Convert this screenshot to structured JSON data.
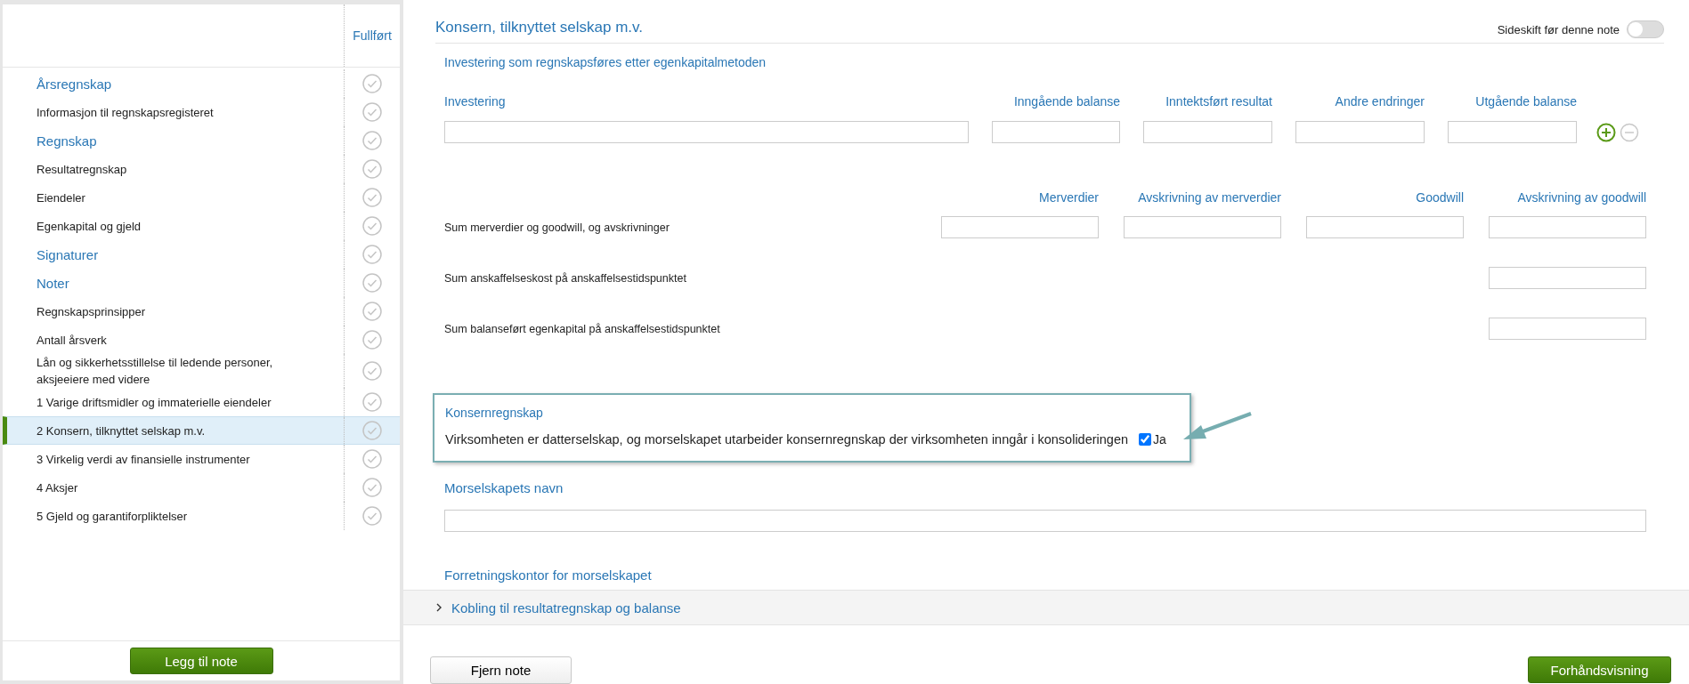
{
  "sidebar": {
    "status_heading": "Fullført",
    "items": [
      {
        "label": "Årsregnskap",
        "kind": "heading",
        "selected": false
      },
      {
        "label": "Informasjon til regnskapsregisteret",
        "kind": "item",
        "selected": false
      },
      {
        "label": "Regnskap",
        "kind": "heading",
        "selected": false
      },
      {
        "label": "Resultatregnskap",
        "kind": "item",
        "selected": false
      },
      {
        "label": "Eiendeler",
        "kind": "item",
        "selected": false
      },
      {
        "label": "Egenkapital og gjeld",
        "kind": "item",
        "selected": false
      },
      {
        "label": "Signaturer",
        "kind": "heading",
        "selected": false
      },
      {
        "label": "Noter",
        "kind": "heading",
        "selected": false
      },
      {
        "label": "Regnskapsprinsipper",
        "kind": "item",
        "selected": false
      },
      {
        "label": "Antall årsverk",
        "kind": "item",
        "selected": false
      },
      {
        "label": "Lån og sikkerhetsstillelse til ledende personer, aksjeeiere med videre",
        "kind": "item",
        "selected": false
      },
      {
        "label": "1 Varige driftsmidler og immaterielle eiendeler",
        "kind": "item",
        "selected": false
      },
      {
        "label": "2 Konsern, tilknyttet selskap m.v.",
        "kind": "item",
        "selected": true
      },
      {
        "label": "3 Virkelig verdi av finansielle instrumenter",
        "kind": "item",
        "selected": false
      },
      {
        "label": "4 Aksjer",
        "kind": "item",
        "selected": false
      },
      {
        "label": "5 Gjeld og garantiforpliktelser",
        "kind": "item",
        "selected": false
      }
    ],
    "add_button": "Legg til note"
  },
  "note": {
    "title": "Konsern, tilknyttet selskap m.v.",
    "page_break": {
      "label": "Sideskift før denne note",
      "on": false
    },
    "investment": {
      "heading": "Investering som regnskapsføres etter egenkapitalmetoden",
      "columns": [
        "Investering",
        "Inngående balanse",
        "Inntektsført resultat",
        "Andre endringer",
        "Utgående balanse"
      ]
    },
    "sums": {
      "columns": [
        "Merverdier",
        "Avskrivning av merverdier",
        "Goodwill",
        "Avskrivning av goodwill"
      ],
      "rows": [
        {
          "label": "Sum merverdier og goodwill, og avskrivninger",
          "kind": "all_columns"
        },
        {
          "label": "Sum anskaffelseskost på anskaffelsestidspunktet",
          "kind": "last_column"
        },
        {
          "label": "Sum balanseført egenkapital på anskaffelsestidspunktet",
          "kind": "last_column"
        }
      ]
    },
    "group": {
      "heading": "Konsernregnskap",
      "statement": "Virksomheten er datterselskap, og morselskapet utarbeider konsernregnskap der virksomheten inngår i konsolideringen",
      "checkbox_label": "Ja",
      "checked": true
    },
    "parent_name_label": "Morselskapets navn",
    "office_label": "Forretningskontor for morselskapet",
    "link_section": {
      "label": "Kobling til resultatregnskap og balanse",
      "expanded": false
    }
  },
  "footer": {
    "remove_button": "Fjern note",
    "preview_button": "Forhåndsvisning"
  }
}
